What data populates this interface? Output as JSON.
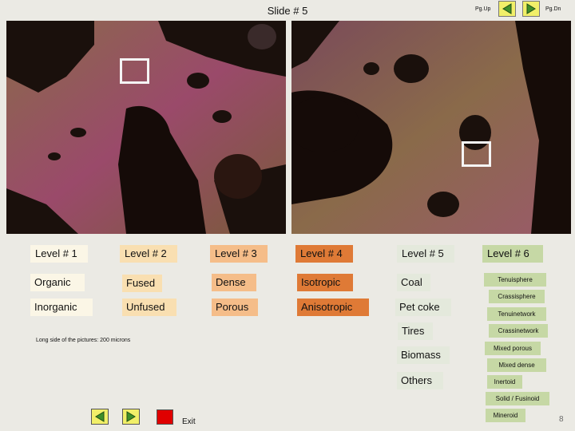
{
  "header": {
    "title": "Slide # 5",
    "pgup_label": "Pg.Up",
    "pgdn_label": "Pg.Dn"
  },
  "levels": [
    "Level # 1",
    "Level # 2",
    "Level # 3",
    "Level # 4",
    "Level # 5",
    "Level # 6"
  ],
  "columns": {
    "col1": [
      "Organic",
      "Inorganic"
    ],
    "col2": [
      "Fused",
      "Unfused"
    ],
    "col3": [
      "Dense",
      "Porous"
    ],
    "col4": [
      "Isotropic",
      "Anisotropic"
    ],
    "col5": [
      "Coal",
      "Pet coke",
      "Tires",
      "Biomass",
      "Others"
    ],
    "col6": [
      "Tenuisphere",
      "Crassisphere",
      "Tenuinetwork",
      "Crassinetwork",
      "Mixed porous",
      "Mixed dense",
      "Inertoid",
      "Solid / Fusinoid",
      "Mineroid"
    ]
  },
  "caption": "Long side of the pictures: 200 microns",
  "footer": {
    "exit_label": "Exit",
    "page_number": "8"
  },
  "colors": {
    "nav_button": "#f1ef69",
    "nav_arrow": "#3f8f2a",
    "stop_button": "#e00000",
    "level4": "#df7a36",
    "level6": "#c6d8a5"
  }
}
